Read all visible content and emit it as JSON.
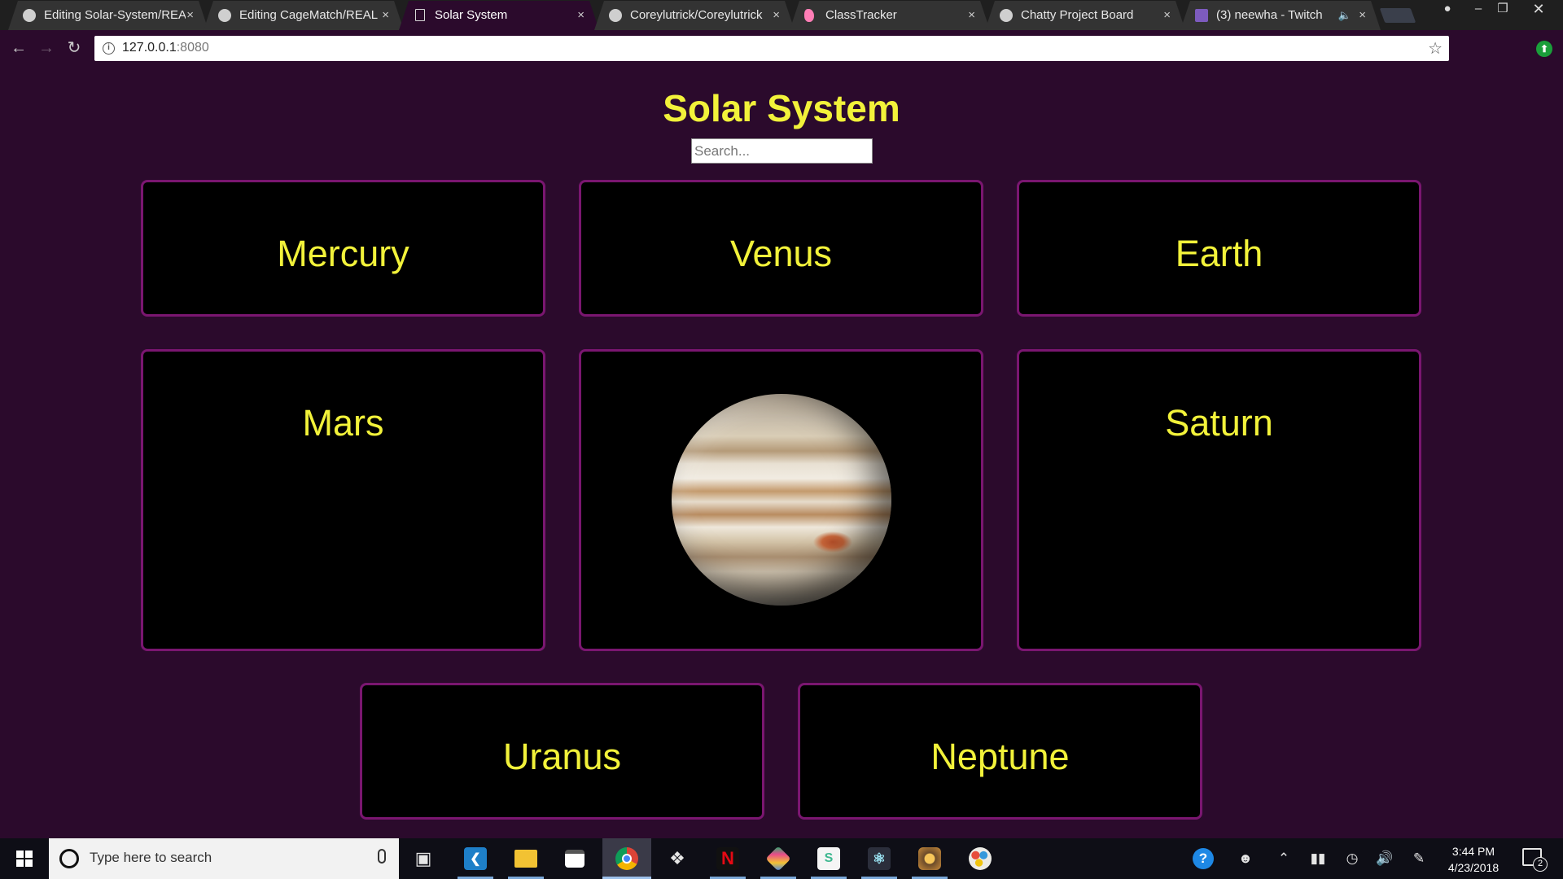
{
  "browser": {
    "tabs": [
      {
        "title": "Editing Solar-System/REA",
        "icon": "github-icon"
      },
      {
        "title": "Editing CageMatch/REAL",
        "icon": "github-icon"
      },
      {
        "title": "Solar System",
        "icon": "document-icon"
      },
      {
        "title": "Coreylutrick/Coreylutrick",
        "icon": "github-icon"
      },
      {
        "title": "ClassTracker",
        "icon": "flamingo-icon"
      },
      {
        "title": "Chatty Project Board",
        "icon": "github-icon"
      },
      {
        "title": "(3) neewha - Twitch",
        "icon": "twitch-icon"
      }
    ],
    "active_tab_index": 2,
    "close_glyph": "×",
    "address": {
      "host": "127.0.0.1",
      "port": ":8080"
    },
    "extension_badge": "⬆"
  },
  "page": {
    "title": "Solar System",
    "search": {
      "placeholder": "Search...",
      "value": ""
    },
    "planets": [
      {
        "name": "Mercury",
        "shows_image": false
      },
      {
        "name": "Venus",
        "shows_image": false
      },
      {
        "name": "Earth",
        "shows_image": false
      },
      {
        "name": "Mars",
        "shows_image": false
      },
      {
        "name": "Jupiter",
        "shows_image": true
      },
      {
        "name": "Saturn",
        "shows_image": false
      },
      {
        "name": "Uranus",
        "shows_image": false
      },
      {
        "name": "Neptune",
        "shows_image": false
      }
    ]
  },
  "taskbar": {
    "search_placeholder": "Type here to search",
    "apps": [
      "task-view-icon",
      "vscode-icon",
      "file-explorer-icon",
      "store-icon",
      "chrome-icon",
      "dropbox-icon",
      "netflix-icon",
      "gitkraken-icon",
      "slack-icon",
      "electron-icon",
      "hearthstone-icon",
      "paint-icon"
    ],
    "netflix_letter": "N",
    "slack_letter": "S",
    "clock": {
      "time": "3:44 PM",
      "date": "4/23/2018"
    },
    "notification_count": "2"
  },
  "colors": {
    "page_background": "#2b0a2c",
    "title_yellow": "#f2f23a",
    "card_border": "#7a1670",
    "card_background": "#000000"
  }
}
